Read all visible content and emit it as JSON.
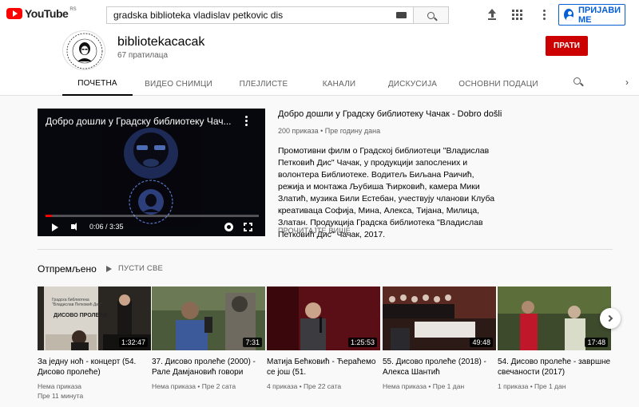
{
  "header": {
    "logo_text": "YouTube",
    "logo_region": "RS",
    "search_value": "gradska biblioteka vladislav petkovic dis",
    "signin_label": "ПРИЈАВИ МЕ"
  },
  "channel": {
    "name": "bibliotekacacak",
    "subscribers": "67 пратилаца",
    "subscribe_label": "ПРАТИ",
    "tabs": [
      "ПОЧЕТНА",
      "ВИДЕО СНИМЦИ",
      "ПЛЕЈЛИСТЕ",
      "КАНАЛИ",
      "ДИСКУСИЈА",
      "ОСНОВНИ ПОДАЦИ"
    ],
    "active_tab": "ПОЧЕТНА"
  },
  "featured": {
    "player_title": "Добро дошли у Градску библиотеку Чач...",
    "time": "0:06 / 3:35",
    "progress": 0.03,
    "title": "Добро дошли у Градску библиотеку Чачак - Dobro došli u G...",
    "meta": "200 приказа • Пре годину дана",
    "description": "Промотивни филм о Градској библиотеци \"Владислав Петковић Дис\" Чачак, у продукцији запослених и волонтера Библиотеке. Водитељ Биљана Раичић, режија и монтажа Љубиша Ћирковић, камера Мики Златић, музика Били Естебан, учествују чланови Клуба креативаца Софија, Мина, Алекса, Тијана, Милица, Златан. Продукција Градска библиотека \"Владислав Петковић Дис\" Чачак, 2017.",
    "read_more": "ПРОЧИТАЈТЕ ВИШЕ"
  },
  "uploads": {
    "title": "Отпремљено",
    "play_all": "ПУСТИ СВЕ",
    "videos": [
      {
        "title": "За једну ноћ - концерт (54. Дисово пролеће)",
        "views": "Нема приказа",
        "age": "Пре 11 минута",
        "duration": "1:32:47"
      },
      {
        "title": "37. Дисово пролеће (2000) - Рале Дамјановић говори",
        "views": "Нема приказа",
        "age": "Пре 2 сата",
        "duration": "7:31"
      },
      {
        "title": "Матија Бећковић - Ћераћемо се још (51.",
        "views": "4 приказа",
        "age": "Пре 22 сата",
        "duration": "1:25:53"
      },
      {
        "title": "55. Дисово пролеће (2018) - Алекса Шантић",
        "views": "Нема приказа",
        "age": "Пре 1 дан",
        "duration": "49:48"
      },
      {
        "title": "54. Дисово пролеће - завршне свечаности (2017)",
        "views": "1 приказа",
        "age": "Пре 1 дан",
        "duration": "17:48"
      }
    ],
    "thumb1_poster_text": "ДИСОВО ПРОЛЕЋЕ"
  },
  "colors": {
    "accent_red": "#cc0000",
    "link_blue": "#065fd4",
    "background": "#f9f9f9"
  }
}
